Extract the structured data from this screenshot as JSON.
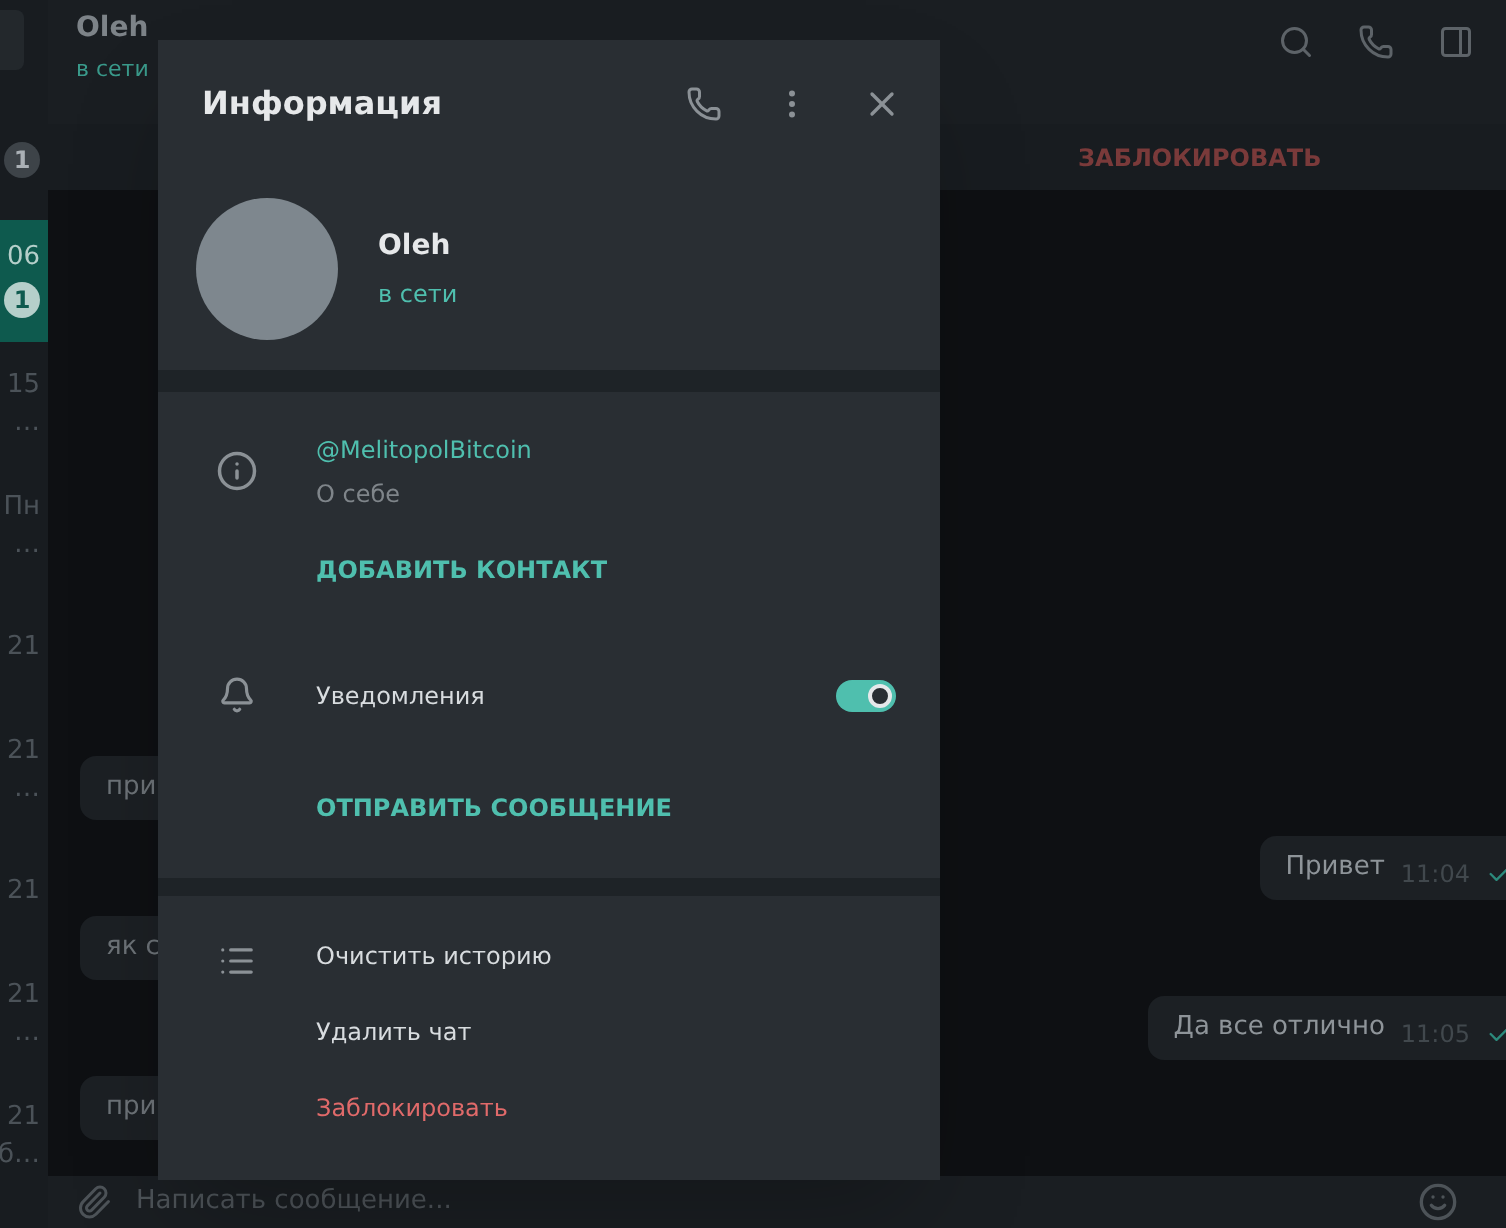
{
  "sidebar": {
    "items": [
      {
        "badge": "1",
        "selected": false
      },
      {
        "time": "06",
        "badge": "1",
        "selected": true
      },
      {
        "time": "15",
        "snippet": "…",
        "selected": false
      },
      {
        "time": "Пн",
        "snippet": "…",
        "selected": false
      },
      {
        "time": "21",
        "selected": false
      },
      {
        "time": "21",
        "snippet": "…",
        "selected": false
      },
      {
        "time": "21",
        "selected": false
      },
      {
        "time": "21",
        "snippet": "…",
        "selected": false
      },
      {
        "time": "21",
        "snippet": "б…",
        "selected": false
      }
    ]
  },
  "chat_header": {
    "name": "Oleh",
    "status": "в сети",
    "block_label": "ЗАБЛОКИРОВАТЬ"
  },
  "messages": [
    {
      "kind": "in",
      "text": "при"
    },
    {
      "kind": "out",
      "text": "Привет",
      "time": "11:04",
      "read": true
    },
    {
      "kind": "in",
      "text": "як с"
    },
    {
      "kind": "out",
      "text": "Да все отлично",
      "time": "11:05",
      "read": true
    },
    {
      "kind": "in",
      "text": "при"
    }
  ],
  "composer": {
    "placeholder": "Написать сообщение..."
  },
  "dialog": {
    "title": "Информация",
    "profile": {
      "name": "Oleh",
      "status": "в сети"
    },
    "info": {
      "username": "@MelitopolBitcoin",
      "bio_label": "О себе",
      "action": "ДОБАВИТЬ КОНТАКТ"
    },
    "notifications": {
      "label": "Уведомления",
      "on": true,
      "action": "ОТПРАВИТЬ СООБЩЕНИЕ"
    },
    "actions": [
      {
        "label": "Очистить историю",
        "kind": "normal"
      },
      {
        "label": "Удалить чат",
        "kind": "normal"
      },
      {
        "label": "Заблокировать",
        "kind": "danger"
      }
    ]
  }
}
